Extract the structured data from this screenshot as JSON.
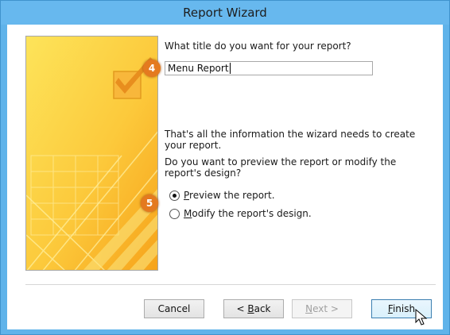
{
  "window": {
    "title": "Report Wizard"
  },
  "form": {
    "prompt": "What title do you want for your report?",
    "title_value": "Menu Report",
    "info_text": "That's all the information the wizard needs to create your report.",
    "question_text": "Do you want to preview the report or modify the report's design?",
    "options": [
      {
        "label_pre": "",
        "label_u": "P",
        "label_post": "review the report.",
        "selected": true
      },
      {
        "label_pre": "",
        "label_u": "M",
        "label_post": "odify the report's design.",
        "selected": false
      }
    ]
  },
  "badges": {
    "step_a": "4",
    "step_b": "5",
    "color": "#e47a1f"
  },
  "buttons": {
    "cancel": "Cancel",
    "back_pre": "< ",
    "back_u": "B",
    "back_post": "ack",
    "next_u": "N",
    "next_post": "ext >",
    "finish_u": "F",
    "finish_post": "inish"
  },
  "colors": {
    "titlebar": "#67b8ee",
    "art_yellow": "#fcd23e",
    "art_orange": "#f7a21b"
  },
  "icons": {
    "art": "report-wizard-art",
    "cursor": "mouse-pointer-icon"
  }
}
